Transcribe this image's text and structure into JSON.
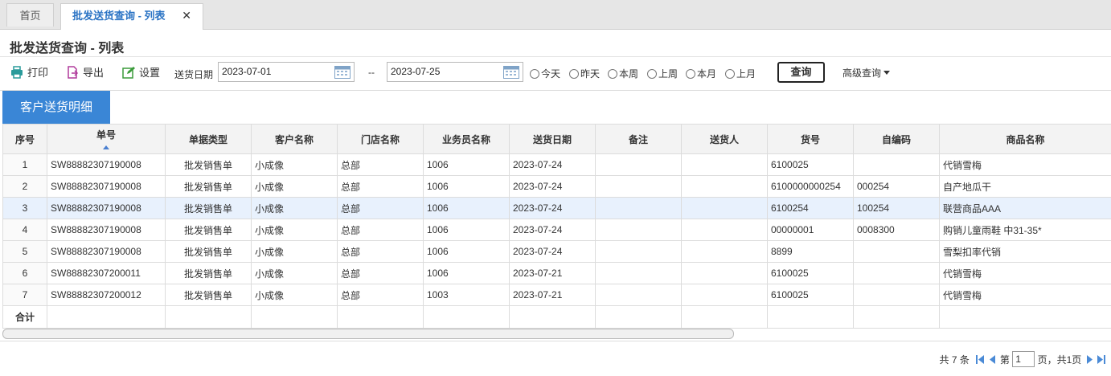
{
  "tabs": {
    "home": "首页",
    "active": "批发送货查询 - 列表",
    "close": "✕"
  },
  "page_title": "批发送货查询 - 列表",
  "toolbar": {
    "print": "打印",
    "export": "导出",
    "settings": "设置",
    "date_label": "送货日期",
    "date_from": "2023-07-01",
    "date_separator": "--",
    "date_to": "2023-07-25",
    "quick_ranges": [
      "今天",
      "昨天",
      "本周",
      "上周",
      "本月",
      "上月"
    ],
    "query": "查询",
    "advanced_query": "高级查询"
  },
  "section_tab": "客户送货明细",
  "grid": {
    "columns": [
      "序号",
      "单号",
      "单据类型",
      "客户名称",
      "门店名称",
      "业务员名称",
      "送货日期",
      "备注",
      "送货人",
      "货号",
      "自编码",
      "商品名称"
    ],
    "rows": [
      [
        "1",
        "SW88882307190008",
        "批发销售单",
        "小成像",
        "总部",
        "1006",
        "2023-07-24",
        "",
        "",
        "6100025",
        "",
        "代销雪梅"
      ],
      [
        "2",
        "SW88882307190008",
        "批发销售单",
        "小成像",
        "总部",
        "1006",
        "2023-07-24",
        "",
        "",
        "6100000000254",
        "000254",
        "自产地瓜干"
      ],
      [
        "3",
        "SW88882307190008",
        "批发销售单",
        "小成像",
        "总部",
        "1006",
        "2023-07-24",
        "",
        "",
        "6100254",
        "100254",
        "联营商品AAA"
      ],
      [
        "4",
        "SW88882307190008",
        "批发销售单",
        "小成像",
        "总部",
        "1006",
        "2023-07-24",
        "",
        "",
        "00000001",
        "0008300",
        "购销儿童雨鞋 中31-35*"
      ],
      [
        "5",
        "SW88882307190008",
        "批发销售单",
        "小成像",
        "总部",
        "1006",
        "2023-07-24",
        "",
        "",
        "8899",
        "",
        "雪梨扣率代销"
      ],
      [
        "6",
        "SW88882307200011",
        "批发销售单",
        "小成像",
        "总部",
        "1006",
        "2023-07-21",
        "",
        "",
        "6100025",
        "",
        "代销雪梅"
      ],
      [
        "7",
        "SW88882307200012",
        "批发销售单",
        "小成像",
        "总部",
        "1003",
        "2023-07-21",
        "",
        "",
        "6100025",
        "",
        "代销雪梅"
      ]
    ],
    "footer_label": "合计"
  },
  "pager": {
    "total_prefix": "共 7 条",
    "page_prefix": "第",
    "page_value": "1",
    "page_suffix": "页，共1页"
  },
  "colors": {
    "accent": "#3a86d6",
    "active_tab_text": "#2a73c4",
    "selected_row": "#e8f1fd"
  }
}
